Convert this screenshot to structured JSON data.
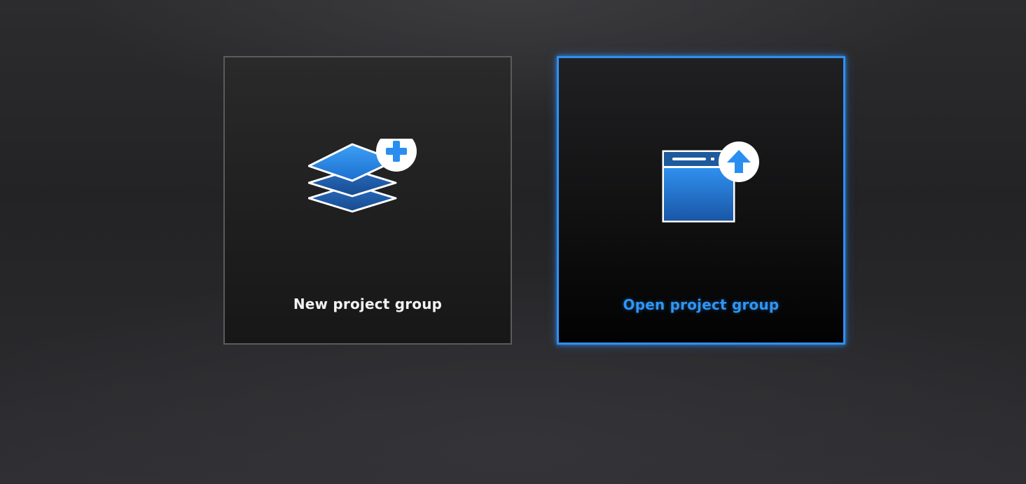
{
  "cards": [
    {
      "label": "New project group",
      "icon": "layers-plus-icon",
      "state": "default"
    },
    {
      "label": "Open project group",
      "icon": "window-upload-icon",
      "state": "selected"
    }
  ],
  "colors": {
    "accent": "#2f8ff2",
    "label_default": "#f2f2f2",
    "label_selected": "#2f95f5",
    "card_border_default": "#5b5b5b"
  }
}
